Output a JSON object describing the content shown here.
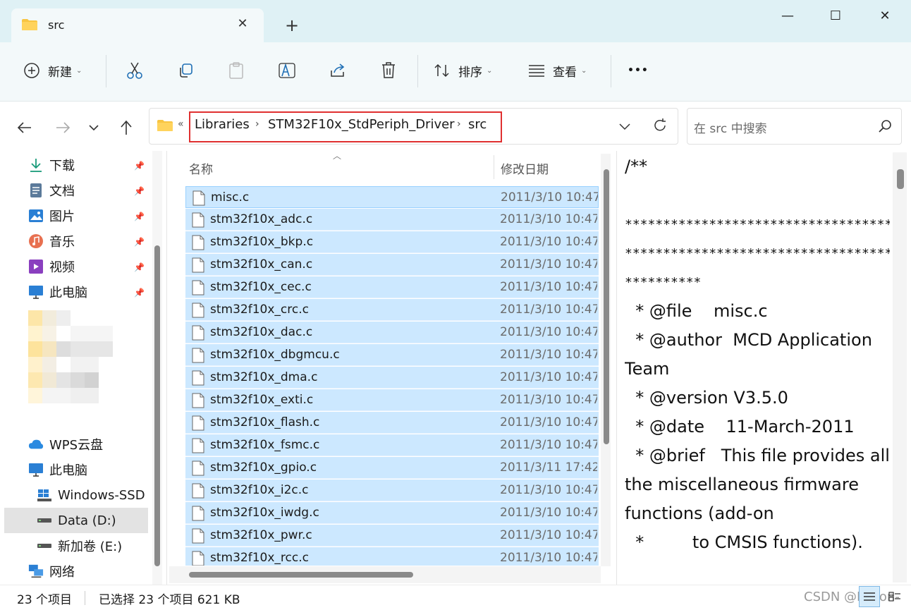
{
  "window": {
    "tab_title": "src",
    "tab_close_icon": "close-icon",
    "new_tab_glyph": "+",
    "minimize_glyph": "—",
    "maximize_glyph": "☐",
    "close_glyph": "✕"
  },
  "toolbar": {
    "new_label": "新建",
    "sort_label": "排序",
    "view_label": "查看",
    "more_glyph": "•••",
    "icons": [
      "cut-icon",
      "copy-icon",
      "paste-icon",
      "rename-icon",
      "share-icon",
      "delete-icon"
    ]
  },
  "address": {
    "overflow_glyph": "«",
    "crumbs": [
      "Libraries",
      "STM32F10x_StdPeriph_Driver",
      "src"
    ],
    "sep_glyph": "›",
    "highlight_color": "#e03030"
  },
  "search": {
    "placeholder": "在 src 中搜索"
  },
  "sidebar": {
    "quick": [
      {
        "label": "下载",
        "icon": "download-icon"
      },
      {
        "label": "文档",
        "icon": "documents-icon"
      },
      {
        "label": "图片",
        "icon": "pictures-icon"
      },
      {
        "label": "音乐",
        "icon": "music-icon"
      },
      {
        "label": "视频",
        "icon": "video-icon"
      },
      {
        "label": "此电脑",
        "icon": "computer-icon"
      }
    ],
    "locations": [
      {
        "label": "WPS云盘",
        "icon": "cloud-icon"
      },
      {
        "label": "此电脑",
        "icon": "computer-icon"
      },
      {
        "label": "Windows-SSD (C:)",
        "icon": "windows-drive-icon"
      },
      {
        "label": "Data (D:)",
        "icon": "drive-icon",
        "selected": true
      },
      {
        "label": "新加卷 (E:)",
        "icon": "drive-icon"
      },
      {
        "label": "网络",
        "icon": "network-icon"
      }
    ]
  },
  "filelist": {
    "col_name": "名称",
    "col_date": "修改日期",
    "selection_color": "#cce8ff",
    "rows": [
      {
        "name": "misc.c",
        "date": "2011/3/10 10:47"
      },
      {
        "name": "stm32f10x_adc.c",
        "date": "2011/3/10 10:47"
      },
      {
        "name": "stm32f10x_bkp.c",
        "date": "2011/3/10 10:47"
      },
      {
        "name": "stm32f10x_can.c",
        "date": "2011/3/10 10:47"
      },
      {
        "name": "stm32f10x_cec.c",
        "date": "2011/3/10 10:47"
      },
      {
        "name": "stm32f10x_crc.c",
        "date": "2011/3/10 10:47"
      },
      {
        "name": "stm32f10x_dac.c",
        "date": "2011/3/10 10:47"
      },
      {
        "name": "stm32f10x_dbgmcu.c",
        "date": "2011/3/10 10:47"
      },
      {
        "name": "stm32f10x_dma.c",
        "date": "2011/3/10 10:47"
      },
      {
        "name": "stm32f10x_exti.c",
        "date": "2011/3/10 10:47"
      },
      {
        "name": "stm32f10x_flash.c",
        "date": "2011/3/10 10:47"
      },
      {
        "name": "stm32f10x_fsmc.c",
        "date": "2011/3/10 10:47"
      },
      {
        "name": "stm32f10x_gpio.c",
        "date": "2011/3/11 17:42"
      },
      {
        "name": "stm32f10x_i2c.c",
        "date": "2011/3/10 10:47"
      },
      {
        "name": "stm32f10x_iwdg.c",
        "date": "2011/3/10 10:47"
      },
      {
        "name": "stm32f10x_pwr.c",
        "date": "2011/3/10 10:47"
      },
      {
        "name": "stm32f10x_rcc.c",
        "date": "2011/3/10 10:47"
      }
    ]
  },
  "preview": {
    "lines": [
      "/**",
      "",
      "************************************",
      "************************************",
      "**********",
      "  * @file    misc.c",
      "  * @author  MCD Application",
      "Team",
      "  * @version V3.5.0",
      "  * @date    11-March-2011",
      "  * @brief   This file provides all",
      "the miscellaneous firmware",
      "functions (add-on",
      "  *         to CMSIS functions)."
    ]
  },
  "status": {
    "count": "23 个项目",
    "selected": "已选择 23 个项目  621 KB",
    "watermark": "CSDN @Leeon-"
  }
}
